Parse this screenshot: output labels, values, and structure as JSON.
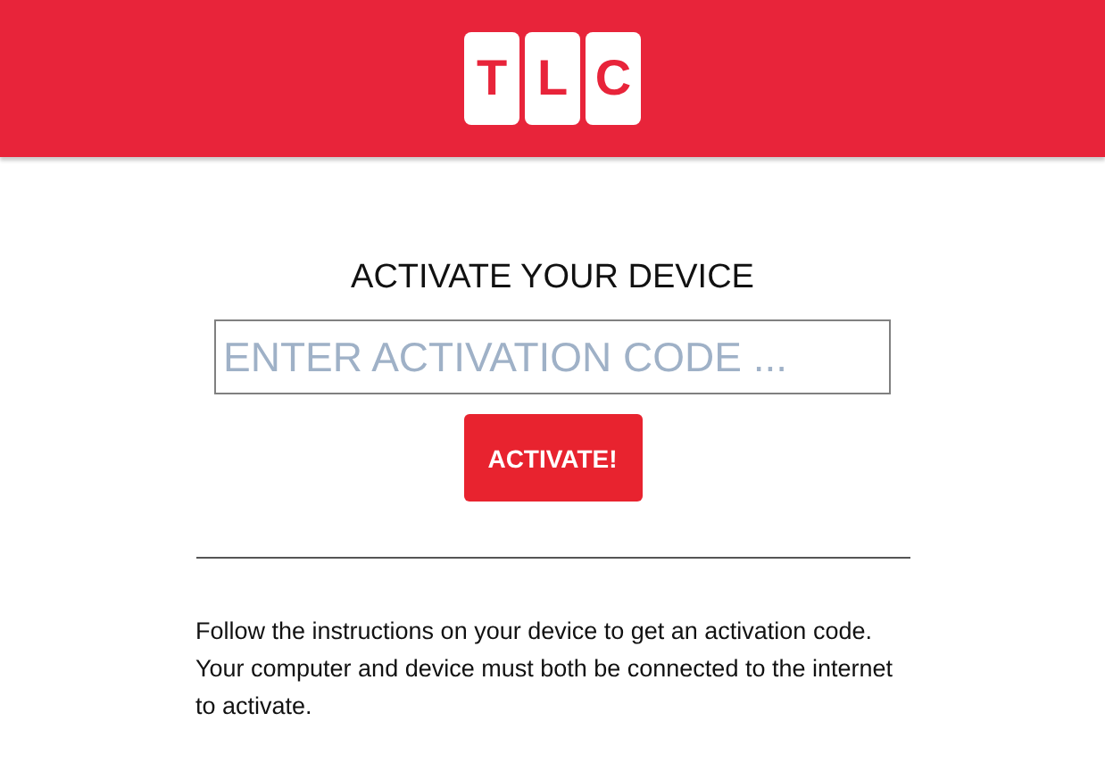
{
  "header": {
    "logo_letters": [
      "T",
      "L",
      "C"
    ]
  },
  "title": "ACTIVATE YOUR DEVICE",
  "code_field": {
    "placeholder": "ENTER ACTIVATION CODE ..."
  },
  "button": "ACTIVATE!",
  "instructions": "Follow the instructions on your device to get an activation code. Your computer and device must both be connected to the internet to activate."
}
